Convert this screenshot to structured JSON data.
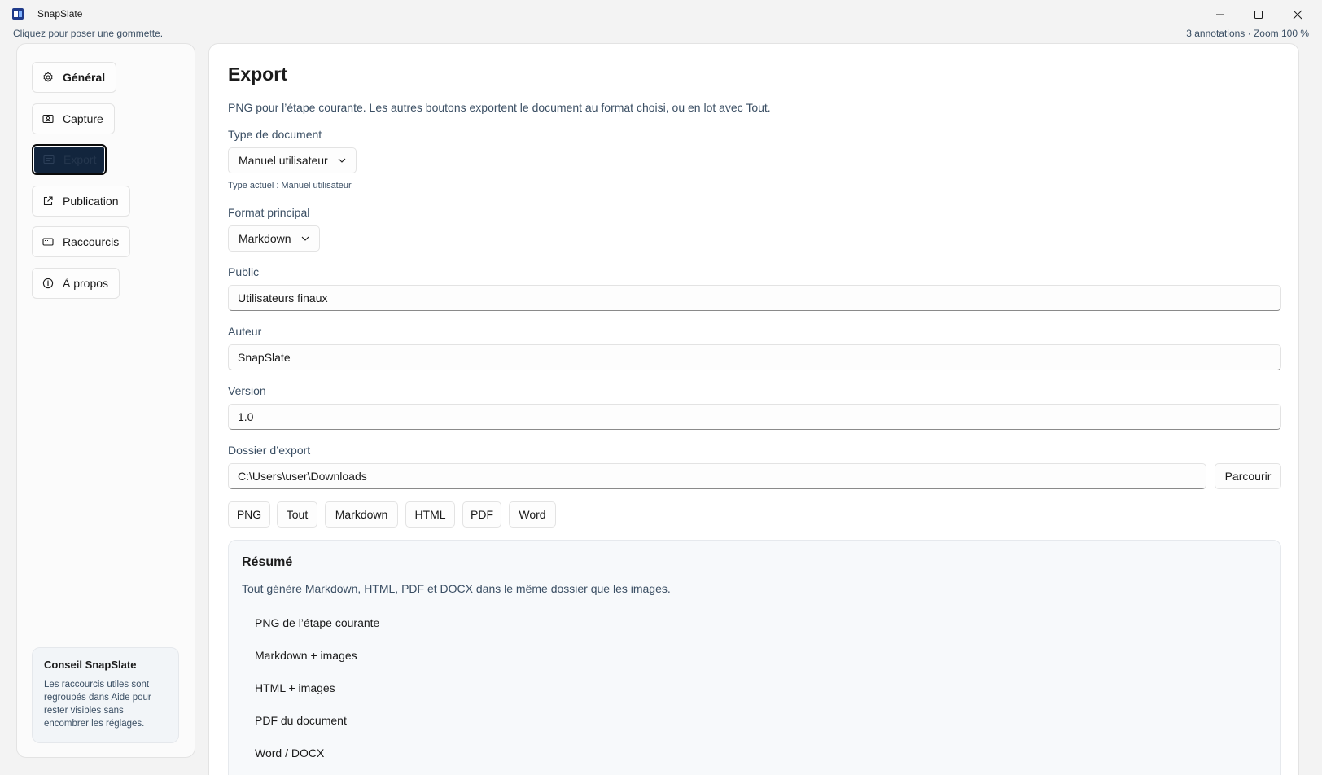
{
  "app": {
    "title": "SnapSlate",
    "hint": "Cliquez pour poser une gommette.",
    "status": "3 annotations · Zoom 100 %"
  },
  "sidebar": {
    "items": [
      {
        "label": "Général",
        "icon": "gear-icon"
      },
      {
        "label": "Capture",
        "icon": "capture-icon"
      },
      {
        "label": "Export",
        "icon": "export-icon",
        "active": true
      },
      {
        "label": "Publication",
        "icon": "share-icon"
      },
      {
        "label": "Raccourcis",
        "icon": "keyboard-icon"
      },
      {
        "label": "À propos",
        "icon": "info-icon"
      }
    ],
    "tip": {
      "title": "Conseil SnapSlate",
      "body": "Les raccourcis utiles sont regroupés dans Aide pour rester visibles sans encombrer les réglages."
    }
  },
  "export": {
    "title": "Export",
    "description": "PNG pour l’étape courante. Les autres boutons exportent le document au format choisi, ou en lot avec Tout.",
    "doc_type_label": "Type de document",
    "doc_type_value": "Manuel utilisateur",
    "doc_type_note": "Type actuel : Manuel utilisateur",
    "format_label": "Format principal",
    "format_value": "Markdown",
    "audience_label": "Public",
    "audience_value": "Utilisateurs finaux",
    "author_label": "Auteur",
    "author_value": "SnapSlate",
    "version_label": "Version",
    "version_value": "1.0",
    "folder_label": "Dossier d’export",
    "folder_value": "C:\\Users\\user\\Downloads",
    "browse_label": "Parcourir",
    "buttons": [
      "PNG",
      "Tout",
      "Markdown",
      "HTML",
      "PDF",
      "Word"
    ]
  },
  "summary": {
    "title": "Résumé",
    "description": "Tout génère Markdown, HTML, PDF et DOCX dans le même dossier que les images.",
    "items": [
      "PNG de l’étape courante",
      "Markdown + images",
      "HTML + images",
      "PDF du document",
      "Word / DOCX"
    ]
  },
  "colors": {
    "accent_dark": "#12253d",
    "secondary_text": "#3b4f64",
    "window_bg": "#f3f3f3"
  }
}
